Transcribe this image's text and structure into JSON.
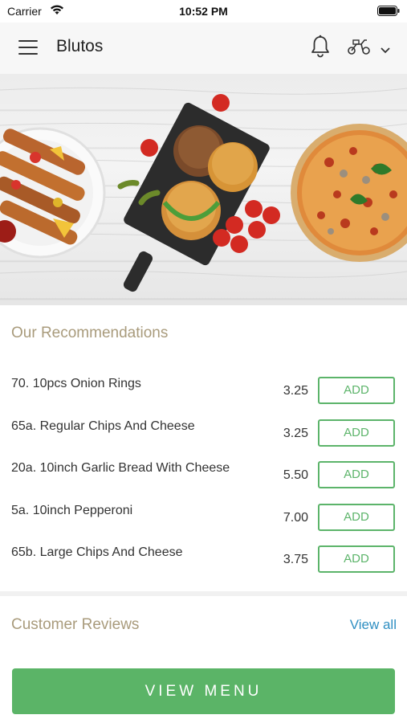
{
  "status_bar": {
    "carrier": "Carrier",
    "time": "10:52 PM"
  },
  "header": {
    "title": "Blutos"
  },
  "recommendations": {
    "title": "Our Recommendations",
    "items": [
      {
        "name": "70. 10pcs Onion Rings",
        "price": "3.25",
        "button": "ADD"
      },
      {
        "name": "65a. Regular Chips And Cheese",
        "price": "3.25",
        "button": "ADD"
      },
      {
        "name": "20a. 10inch Garlic Bread With Cheese",
        "price": "5.50",
        "button": "ADD"
      },
      {
        "name": "5a. 10inch Pepperoni",
        "price": "7.00",
        "button": "ADD"
      },
      {
        "name": "65b. Large Chips And Cheese",
        "price": "3.75",
        "button": "ADD"
      }
    ]
  },
  "reviews": {
    "title": "Customer Reviews",
    "view_all": "View all"
  },
  "footer": {
    "view_menu": "VIEW MENU"
  },
  "colors": {
    "accent_green": "#5bb467",
    "section_title": "#a99b7c",
    "link_blue": "#2f8fc2"
  }
}
